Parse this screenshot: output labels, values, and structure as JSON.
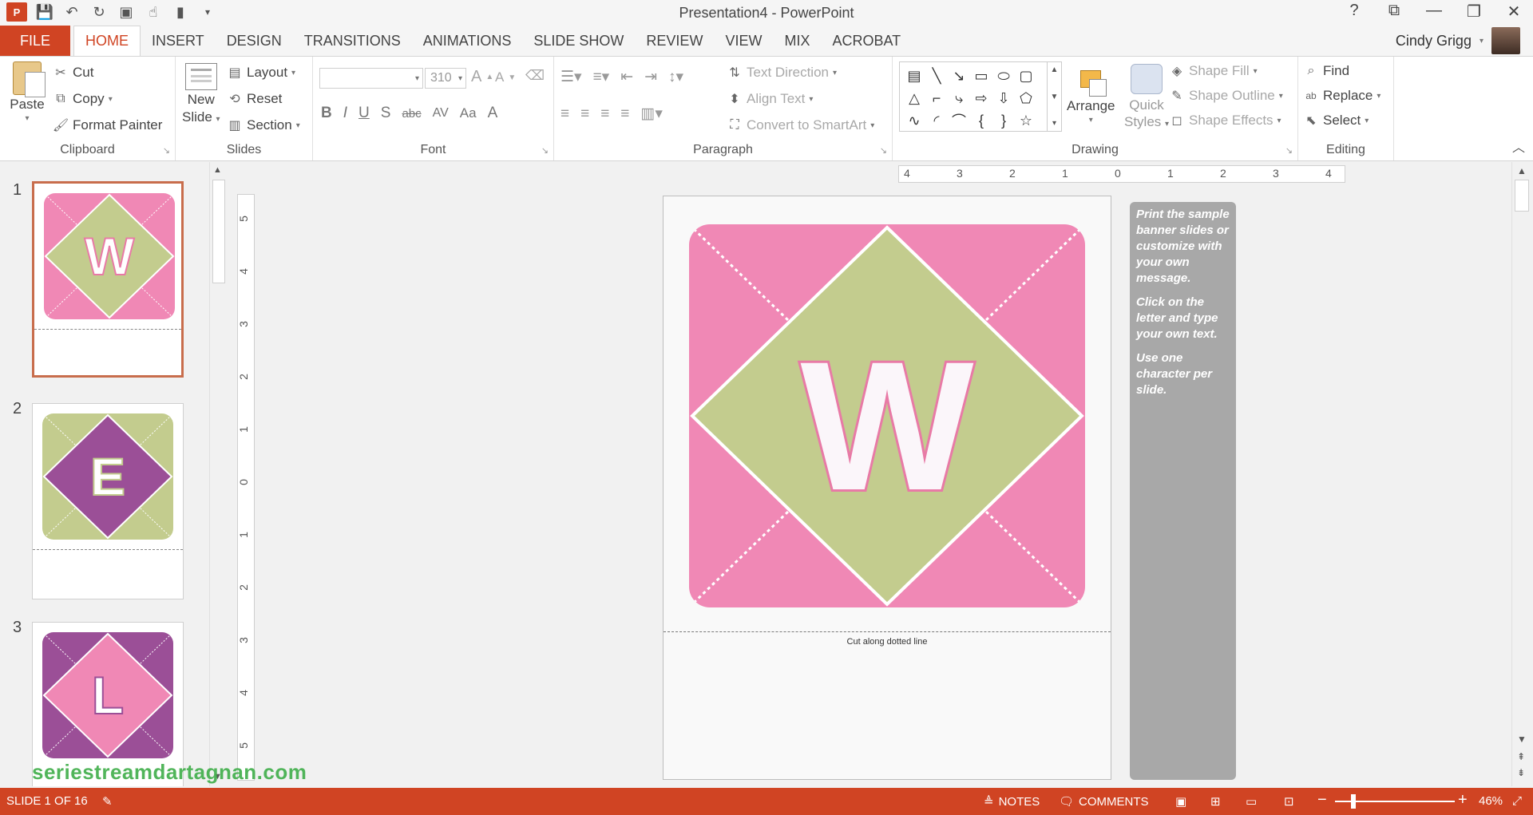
{
  "app": {
    "title": "Presentation4 - PowerPoint",
    "logo": "P",
    "colors": {
      "accent": "#d04423",
      "pink": "#f088b5",
      "green": "#c3cc8e",
      "purple": "#9b4f97"
    }
  },
  "window": {
    "help": "?",
    "restore_ribbon": "⧉",
    "minimize": "—",
    "maximize": "❐",
    "close": "✕"
  },
  "tabs": {
    "file": "FILE",
    "items": [
      "HOME",
      "INSERT",
      "DESIGN",
      "TRANSITIONS",
      "ANIMATIONS",
      "SLIDE SHOW",
      "REVIEW",
      "VIEW",
      "MIX",
      "ACROBAT"
    ],
    "active": "HOME"
  },
  "user": {
    "name": "Cindy Grigg"
  },
  "ribbon": {
    "clipboard": {
      "label": "Clipboard",
      "paste": "Paste",
      "cut": "Cut",
      "copy": "Copy",
      "format_painter": "Format Painter"
    },
    "slides": {
      "label": "Slides",
      "new_slide_1": "New",
      "new_slide_2": "Slide",
      "layout": "Layout",
      "reset": "Reset",
      "section": "Section"
    },
    "font": {
      "label": "Font",
      "font_name": "",
      "font_size": "310",
      "grow": "A",
      "shrink": "A",
      "bold": "B",
      "italic": "I",
      "underline": "U",
      "strike": "S",
      "strike2": "abc",
      "spacing": "AV",
      "case": "Aa",
      "color": "A"
    },
    "paragraph": {
      "label": "Paragraph",
      "text_direction": "Text Direction",
      "align_text": "Align Text",
      "convert_smartart": "Convert to SmartArt"
    },
    "drawing": {
      "label": "Drawing",
      "arrange": "Arrange",
      "quick_styles_1": "Quick",
      "quick_styles_2": "Styles",
      "shape_fill": "Shape Fill",
      "shape_outline": "Shape Outline",
      "shape_effects": "Shape Effects"
    },
    "editing": {
      "label": "Editing",
      "find": "Find",
      "replace": "Replace",
      "select": "Select"
    }
  },
  "thumbnails": [
    {
      "number": "1",
      "letter": "W"
    },
    {
      "number": "2",
      "letter": "E"
    },
    {
      "number": "3",
      "letter": "L"
    }
  ],
  "slide": {
    "letter": "W",
    "cut_label": "Cut along dotted line",
    "notes": [
      "Print the sample banner slides or customize with your own message.",
      "Click on the letter and type your own text.",
      "Use one character per slide."
    ]
  },
  "ruler": {
    "h": [
      "4",
      "3",
      "2",
      "1",
      "0",
      "1",
      "2",
      "3",
      "4"
    ],
    "v": [
      "5",
      "4",
      "3",
      "2",
      "1",
      "0",
      "1",
      "2",
      "3",
      "4",
      "5"
    ]
  },
  "status": {
    "slide_info": "SLIDE 1 OF 16",
    "notes": "NOTES",
    "comments": "COMMENTS",
    "zoom": "46%",
    "zoom_minus": "−",
    "zoom_plus": "+"
  },
  "watermark": "seriestreamdartagnan.com"
}
